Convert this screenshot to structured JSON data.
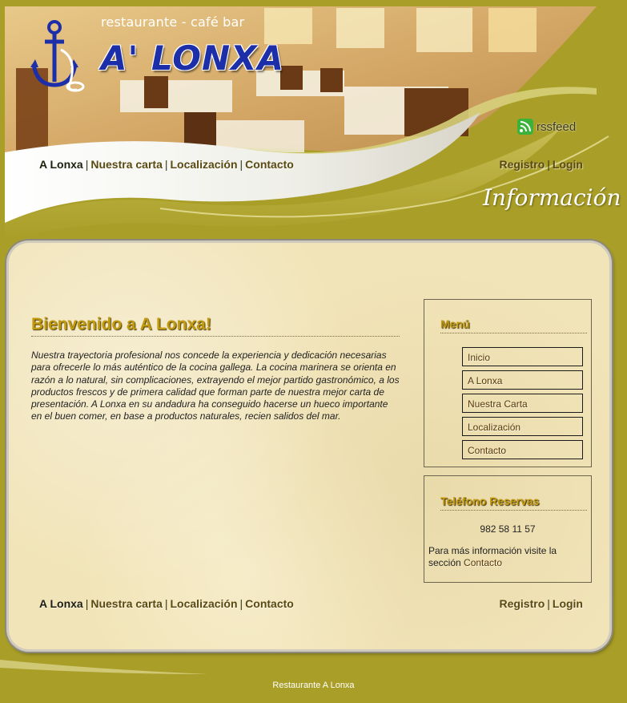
{
  "brand": {
    "tagline": "restaurante - café bar",
    "name": "A' LONXA"
  },
  "rss": {
    "label": "rssfeed"
  },
  "nav": {
    "links": [
      "A Lonxa",
      "Nuestra carta",
      "Localización",
      "Contacto"
    ],
    "account": [
      "Registro",
      "Login"
    ],
    "separator": "|"
  },
  "section_title": "Información",
  "welcome": {
    "title": "Bienvenido a A Lonxa!",
    "text": "Nuestra trayectoria profesional nos concede la experiencia y dedicación necesarias para ofrecerle lo más auténtico de la cocina gallega. La cocina marinera se orienta en razón a lo natural, sin complicaciones, extrayendo el mejor partido gastronómico, a los productos frescos y de primera calidad que forman parte de nuestra mejor carta de presentación. A Lonxa en su andadura ha conseguido hacerse un hueco importante en el buen comer, en base a productos naturales, recien salidos del mar."
  },
  "menu": {
    "title": "Menú",
    "items": [
      "Inicio",
      "A Lonxa",
      "Nuestra Carta",
      "Localización",
      "Contacto"
    ]
  },
  "reservas": {
    "title": "Teléfono Reservas",
    "phone": "982 58 11 57",
    "info": "Para más información visite la sección",
    "link": "Contacto"
  },
  "footer": {
    "text": "Restaurante A Lonxa"
  },
  "colors": {
    "background": "#a99e27",
    "panel": "#f1e4b8",
    "heading": "#c29a10",
    "brand_blue": "#1d2fa8"
  }
}
